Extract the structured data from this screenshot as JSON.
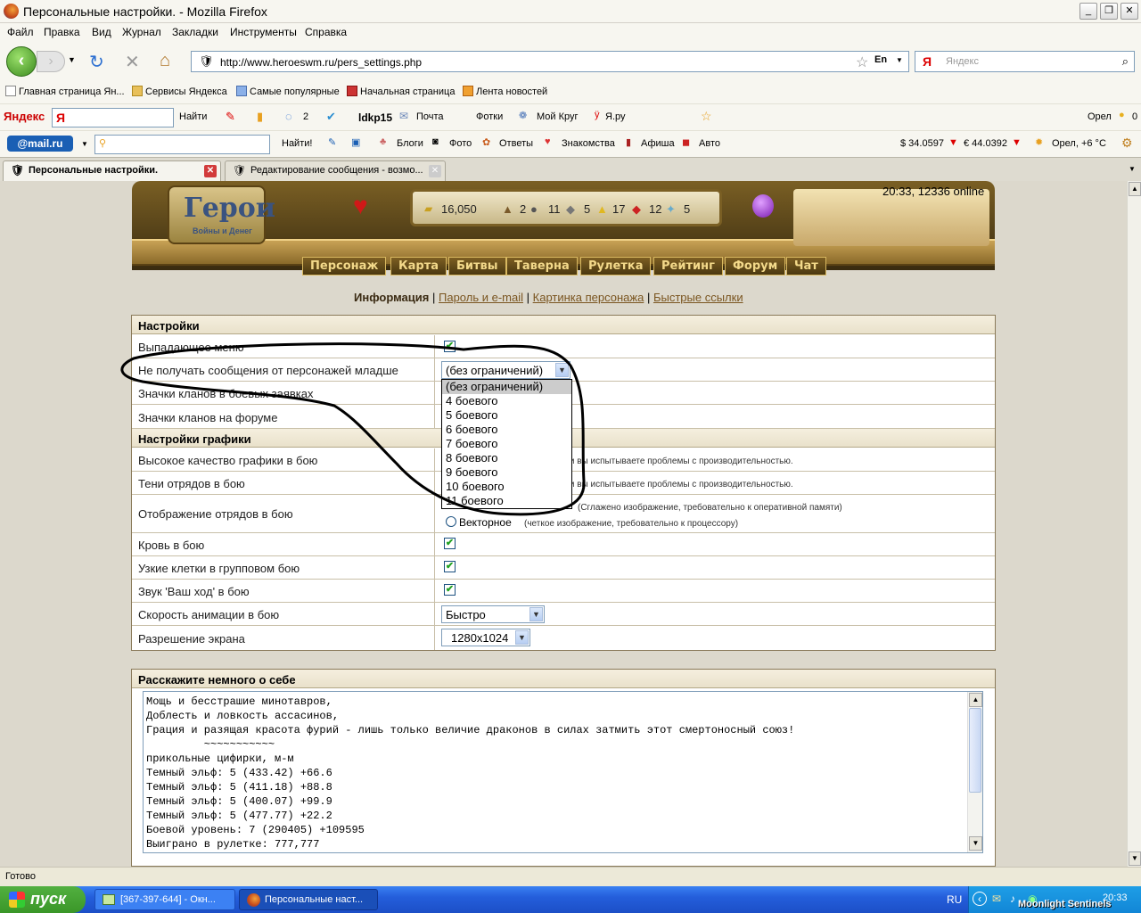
{
  "window": {
    "title": "Персональные настройки. - Mozilla Firefox"
  },
  "menu": [
    "Файл",
    "Правка",
    "Вид",
    "Журнал",
    "Закладки",
    "Инструменты",
    "Справка"
  ],
  "nav": {
    "url": "http://www.heroeswm.ru/pers_settings.php",
    "lang": "En",
    "search_placeholder": "Яндекс"
  },
  "bookmarks": [
    "Главная страница Ян...",
    "Сервисы Яндекса",
    "Самые популярные",
    "Начальная страница",
    "Лента новостей"
  ],
  "yandex_bar": {
    "logo": "Яндекс",
    "find": "Найти",
    "count": "2",
    "user": "ldkp15",
    "mail": "Почта",
    "photos": "Фотки",
    "circle": "Мой Круг",
    "yaru": "Я.ру",
    "city": "Орел",
    "zero": "0"
  },
  "mail_bar": {
    "logo": "@mail.ru",
    "find": "Найти!",
    "items": [
      "Блоги",
      "Фото",
      "Ответы",
      "Знакомства",
      "Афиша",
      "Авто"
    ],
    "usd": "$ 34.0597",
    "eur": "€ 44.0392",
    "weather": "Орел, +6 °C"
  },
  "tabs": [
    {
      "label": "Персональные настройки."
    },
    {
      "label": "Редактирование сообщения - возмо..."
    }
  ],
  "game": {
    "logo_title": "Герои",
    "logo_sub": "Войны и Денег",
    "time_online": "20:33, 12336 online",
    "resources": [
      "16,050",
      "2",
      "11",
      "5",
      "17",
      "12",
      "5"
    ],
    "menu": [
      "Персонаж",
      "Карта",
      "Битвы",
      "Таверна",
      "Рулетка",
      "Рейтинг",
      "Форум",
      "Чат"
    ]
  },
  "sublinks": {
    "active": "Информация",
    "sep": "|",
    "links": [
      "Пароль и e-mail",
      "Картинка персонажа",
      "Быстрые ссылки"
    ]
  },
  "settings": {
    "section1": "Настройки",
    "dropdown_menu": "Выпадающее меню",
    "no_messages": "Не получать сообщения от персонажей младше",
    "no_messages_value": "(без ограничений)",
    "clan_battle": "Значки кланов в боевых заявках",
    "clan_forum": "Значки кланов на форуме",
    "section2": "Настройки графики",
    "hq": "Высокое качество графики в бою",
    "hq_note": "сли вы испытываете проблемы с производительностью.",
    "shadows": "Тени отрядов в бою",
    "shadows_note": "сли вы испытываете проблемы с производительностью.",
    "display": "Отображение отрядов в бою",
    "raster_note": "(Сглажено изображение, требовательно к оперативной памяти)",
    "vector": "Векторное",
    "vector_note": "(четкое изображение, требовательно к процессору)",
    "blood": "Кровь в бою",
    "narrow": "Узкие клетки в групповом бою",
    "sound": "Звук 'Ваш ход' в бою",
    "speed": "Скорость анимации в бою",
    "speed_value": "Быстро",
    "resolution": "Разрешение экрана",
    "resolution_value": "1280x1024"
  },
  "dropdown_options": [
    "(без ограничений)",
    "4 боевого",
    "5 боевого",
    "6 боевого",
    "7 боевого",
    "8 боевого",
    "9 боевого",
    "10 боевого",
    "11 боевого"
  ],
  "about": {
    "title": "Расскажите немного о себе",
    "text": "Мощь и бесстрашие минотавров,\nДоблесть и ловкость ассасинов,\nГрация и разящая красота фурий - лишь только величие драконов в силах затмить этот смертоносный союз!\n         ~~~~~~~~~~~\nприкольные цифирки, м-м\nТемный эльф: 5 (433.42) +66.6\nТемный эльф: 5 (411.18) +88.8\nТемный эльф: 5 (400.07) +99.9\nТемный эльф: 5 (477.77) +22.2\nБоевой уровень: 7 (290405) +109595\nВыиграно в рулетке: 777,777"
  },
  "status": "Готово",
  "taskbar": {
    "start": "пуск",
    "items": [
      "[367-397-644] - Окн...",
      "Персональные наст..."
    ],
    "lang": "RU",
    "clock": "20:33",
    "watermark": "Moonlight Sentinels"
  }
}
